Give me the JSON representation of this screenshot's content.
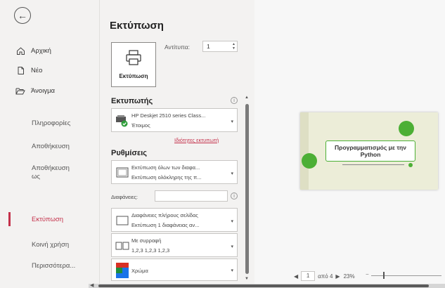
{
  "sidebar": {
    "back_icon": "back-arrow-icon",
    "items": [
      {
        "label": "Αρχική",
        "icon": "home-icon"
      },
      {
        "label": "Νέο",
        "icon": "new-document-icon"
      },
      {
        "label": "Άνοιγμα",
        "icon": "folder-open-icon"
      },
      {
        "label": "Πληροφορίες"
      },
      {
        "label": "Αποθήκευση"
      },
      {
        "label": "Αποθήκευση ως"
      },
      {
        "label": "Εκτύπωση"
      },
      {
        "label": "Κοινή χρήση"
      },
      {
        "label": "Περισσότερα..."
      }
    ],
    "active_color": "#c4314b"
  },
  "panel": {
    "title": "Εκτύπωση",
    "print_button_label": "Εκτύπωση",
    "copies_label": "Αντίτυπα:",
    "copies_value": "1",
    "printer_heading": "Εκτυπωτής",
    "printer_name": "HP Deskjet 2510 series Class...",
    "printer_status": "Έτοιμος",
    "printer_properties_link": "Ιδιότητες εκτυπωτή",
    "settings_heading": "Ρυθμίσεις",
    "settings": [
      {
        "line1": "Εκτύπωση όλων των διαφα...",
        "line2": "Εκτύπωση ολόκληρης της π..."
      },
      {
        "line1": "Διαφάνειες πλήρους σελίδας",
        "line2": "Εκτύπωση 1 διαφάνειας αν..."
      },
      {
        "line1": "Με συρραφή",
        "line2": "1,2,3   1,2,3   1,2,3"
      },
      {
        "line1": "Χρώμα",
        "line2": ""
      }
    ],
    "slides_label": "Διαφάνειες:",
    "slides_value": ""
  },
  "preview": {
    "slide_title": "Προγραμματισμός με την Python",
    "page_current": "1",
    "page_total_text": "από 4",
    "zoom_text": "23%"
  },
  "colors": {
    "accent": "#c4314b",
    "slide_green": "#4caf35",
    "slide_bg": "#ecedd8"
  }
}
